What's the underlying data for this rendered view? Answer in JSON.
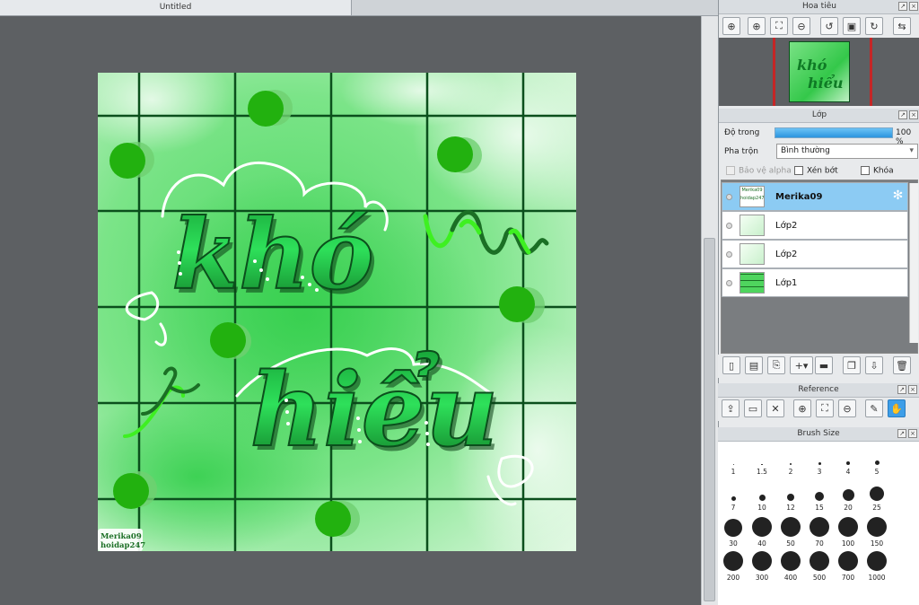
{
  "document": {
    "tab_title": "Untitled"
  },
  "artwork": {
    "word1": "khó",
    "word2": "hiểu",
    "watermark_line1": "Merika09",
    "watermark_line2": "hoidap247"
  },
  "navigator": {
    "title": "Hoa tiêu",
    "tools": [
      "zoom-in-icon",
      "zoom-in-icon",
      "fit-icon",
      "zoom-out-icon",
      "rotate-left-icon",
      "actual-size-icon",
      "rotate-right-icon",
      "flip-icon"
    ]
  },
  "layer_panel": {
    "title": "Lớp",
    "opacity_label": "Độ trong",
    "opacity_value": "100 %",
    "opacity_percent": 100,
    "blend_label": "Pha trộn",
    "blend_value": "Bình thường",
    "protect_alpha_label": "Bảo vệ alpha",
    "clip_label": "Xén bớt",
    "lock_label": "Khóa",
    "layers": [
      {
        "name": "Merika09",
        "selected": true,
        "thumb_text": "Merika09 hoidap247"
      },
      {
        "name": "Lớp2",
        "selected": false
      },
      {
        "name": "Lớp2",
        "selected": false
      },
      {
        "name": "Lớp1",
        "selected": false
      }
    ]
  },
  "reference": {
    "title": "Reference"
  },
  "brush_size": {
    "title": "Brush Size",
    "sizes": [
      "1",
      "1.5",
      "2",
      "3",
      "4",
      "5",
      "7",
      "10",
      "12",
      "15",
      "20",
      "25",
      "30",
      "40",
      "50",
      "70",
      "100",
      "150",
      "200",
      "300",
      "400",
      "500",
      "700",
      "1000"
    ]
  },
  "colors": {
    "accent": "#3d9ee8",
    "selected_layer": "#8ccbf3",
    "grid": "#0b4f1c",
    "green_dot": "#22b10f",
    "neon": "#3ef021",
    "dark_green": "#1b6f25"
  }
}
